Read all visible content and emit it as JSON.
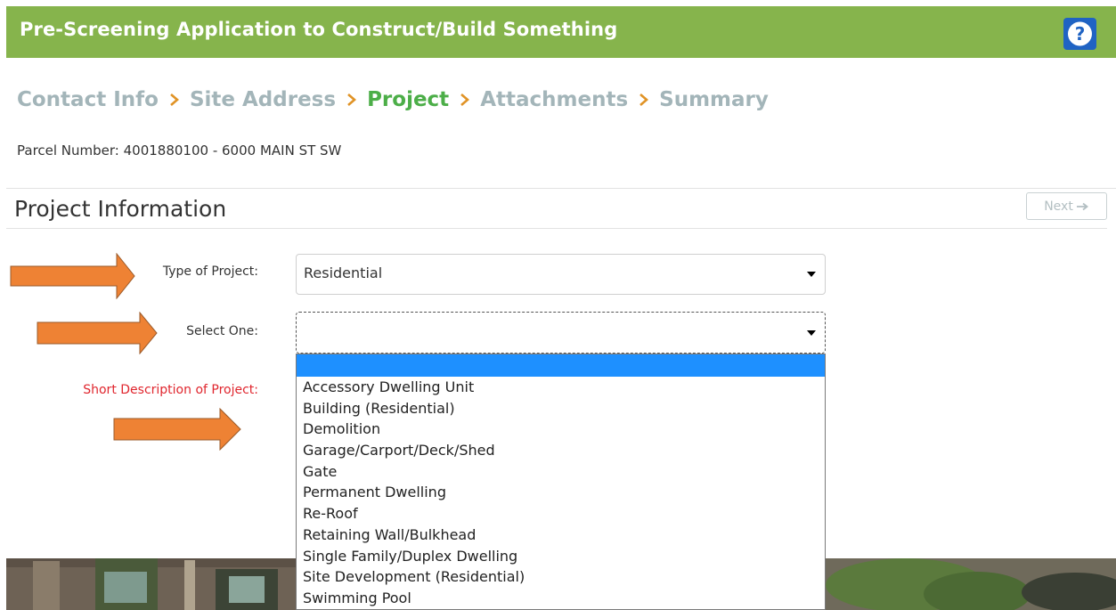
{
  "header": {
    "title": "Pre-Screening Application to Construct/Build Something",
    "help_glyph": "?",
    "bg_color": "#86b44c",
    "help_color": "#1f63c3"
  },
  "breadcrumb": {
    "steps": [
      {
        "label": "Contact Info",
        "active": false
      },
      {
        "label": "Site Address",
        "active": false
      },
      {
        "label": "Project",
        "active": true
      },
      {
        "label": "Attachments",
        "active": false
      },
      {
        "label": "Summary",
        "active": false
      }
    ],
    "inactive_color": "#a3b5b9",
    "active_color": "#4cae48",
    "separator_color": "#e09326"
  },
  "parcel": {
    "text": "Parcel Number: 4001880100 - 6000 MAIN ST SW"
  },
  "section": {
    "title": "Project Information",
    "next_label": "Next",
    "next_icon": "arrow-right-icon"
  },
  "form": {
    "type_label": "Type of Project:",
    "type_value": "Residential",
    "select_one_label": "Select One:",
    "select_one_value": "",
    "description_label": "Short Description of Project:"
  },
  "dropdown": {
    "highlighted_index": 0,
    "options": [
      "",
      "Accessory Dwelling Unit",
      "Building (Residential)",
      "Demolition",
      "Garage/Carport/Deck/Shed",
      "Gate",
      "Permanent Dwelling",
      "Re-Roof",
      "Retaining Wall/Bulkhead",
      "Single Family/Duplex Dwelling",
      "Site Development (Residential)",
      "Swimming Pool"
    ],
    "highlight_color": "#1e90ff"
  },
  "annotations": {
    "arrow_color": "#ee8234",
    "arrow_stroke": "#9a5a2a"
  }
}
